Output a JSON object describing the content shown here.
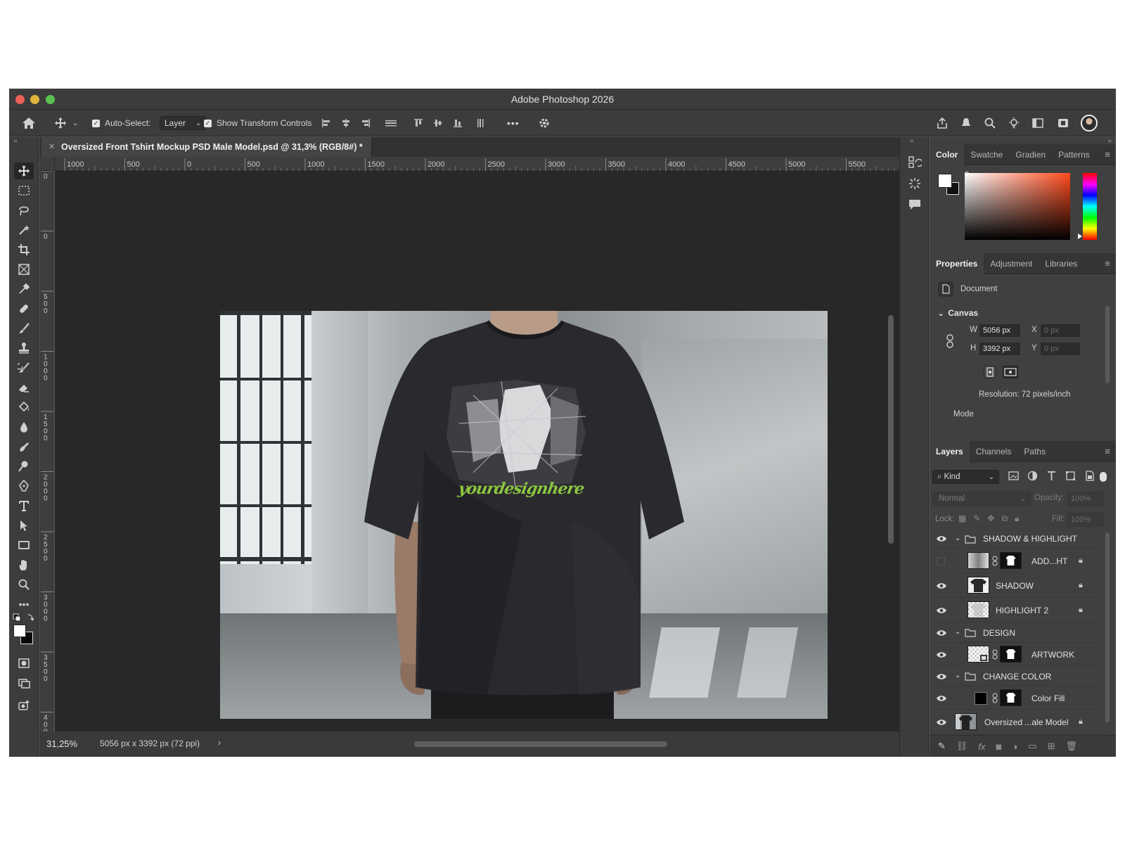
{
  "window": {
    "title": "Adobe Photoshop 2026"
  },
  "options_bar": {
    "auto_select_label": "Auto-Select:",
    "auto_select_value": "Layer",
    "show_transform_label": "Show Transform Controls",
    "more_label": "•••"
  },
  "document": {
    "tab_title": "Oversized Front Tshirt Mockup PSD Male Model.psd @ 31,3% (RGB/8#) *",
    "zoom": "31,25%",
    "doc_info": "5056 px x 3392 px (72 ppi)",
    "ruler_labels": [
      "1000",
      "500",
      "0",
      "500",
      "1000",
      "1500",
      "2000",
      "2500",
      "3000",
      "3500",
      "4000",
      "4500",
      "5000",
      "5500"
    ],
    "vruler_labels": [
      "0",
      "0",
      "500",
      "1000",
      "1500",
      "2000",
      "2500",
      "3000",
      "3500",
      "4000"
    ],
    "artwork_text": "yourdesignhere"
  },
  "color_panel": {
    "tabs": [
      "Color",
      "Swatche",
      "Gradien",
      "Patterns"
    ],
    "hue_color": "#ff4a1c"
  },
  "properties_panel": {
    "tabs": [
      "Properties",
      "Adjustment",
      "Libraries"
    ],
    "doc_label": "Document",
    "canvas_label": "Canvas",
    "w_label": "W",
    "w_value": "5056 px",
    "h_label": "H",
    "h_value": "3392 px",
    "x_label": "X",
    "x_placeholder": "0 px",
    "y_label": "Y",
    "y_placeholder": "0 px",
    "resolution": "Resolution: 72 pixels/inch",
    "mode_label": "Mode"
  },
  "layers_panel": {
    "tabs": [
      "Layers",
      "Channels",
      "Paths"
    ],
    "kind_label": "Kind",
    "blend_mode": "Normal",
    "opacity_label": "Opacity:",
    "opacity_value": "100%",
    "lock_label": "Lock:",
    "fill_label": "Fill:",
    "fill_value": "100%",
    "layers": [
      {
        "name": "SHADOW & HIGHLIGHT",
        "kind": "group"
      },
      {
        "name": "ADD...HT",
        "kind": "masked"
      },
      {
        "name": "SHADOW",
        "kind": "layer"
      },
      {
        "name": "HIGHLIGHT 2",
        "kind": "layer"
      },
      {
        "name": "DESIGN",
        "kind": "group"
      },
      {
        "name": "ARTWORK",
        "kind": "masked"
      },
      {
        "name": "CHANGE COLOR",
        "kind": "group"
      },
      {
        "name": "Color Fill",
        "kind": "fill"
      },
      {
        "name": "Oversized ...ale Model",
        "kind": "photo"
      }
    ]
  }
}
